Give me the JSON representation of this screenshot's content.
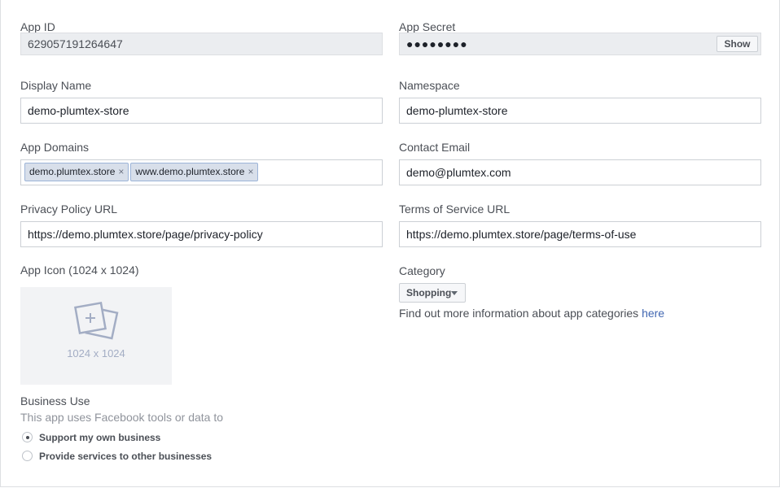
{
  "app_id": {
    "label": "App ID",
    "value": "629057191264647"
  },
  "app_secret": {
    "label": "App Secret",
    "value": "●●●●●●●●",
    "show_label": "Show"
  },
  "display_name": {
    "label": "Display Name",
    "value": "demo-plumtex-store"
  },
  "namespace": {
    "label": "Namespace",
    "value": "demo-plumtex-store"
  },
  "app_domains": {
    "label": "App Domains",
    "tags": [
      "demo.plumtex.store",
      "www.demo.plumtex.store"
    ],
    "remove_glyph": "×"
  },
  "contact_email": {
    "label": "Contact Email",
    "value": "demo@plumtex.com"
  },
  "privacy_policy": {
    "label": "Privacy Policy URL",
    "value": "https://demo.plumtex.store/page/privacy-policy"
  },
  "terms_of_service": {
    "label": "Terms of Service URL",
    "value": "https://demo.plumtex.store/page/terms-of-use"
  },
  "app_icon": {
    "label": "App Icon (1024 x 1024)",
    "caption": "1024 x 1024",
    "icon": "image-add-icon"
  },
  "category": {
    "label": "Category",
    "selected": "Shopping",
    "info_text": "Find out more information about app categories ",
    "info_link": "here"
  },
  "business_use": {
    "label": "Business Use",
    "description": "This app uses Facebook tools or data to",
    "options": [
      {
        "label": "Support my own business",
        "checked": true
      },
      {
        "label": "Provide services to other businesses",
        "checked": false
      }
    ]
  },
  "colors": {
    "link": "#4267b2",
    "tag_bg": "#d8dfea",
    "tag_border": "#9cb4d8",
    "readonly_bg": "#ebedf0"
  }
}
